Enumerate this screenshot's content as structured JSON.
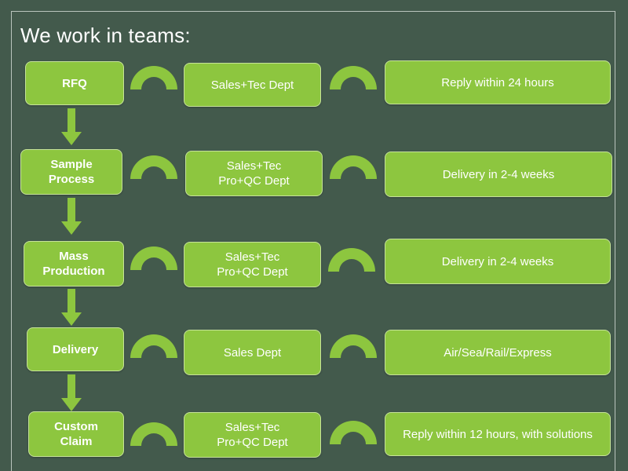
{
  "title": "We work in teams:",
  "colors": {
    "background": "#435a4c",
    "box_fill": "#8dc63f",
    "text": "#ffffff"
  },
  "rows": [
    {
      "step": "RFQ",
      "team": "Sales+Tec Dept",
      "result": "Reply within 24 hours"
    },
    {
      "step": "Sample\nProcess",
      "team": "Sales+Tec\nPro+QC Dept",
      "result": "Delivery in 2-4 weeks"
    },
    {
      "step": "Mass\nProduction",
      "team": "Sales+Tec\nPro+QC Dept",
      "result": "Delivery in 2-4 weeks"
    },
    {
      "step": "Delivery",
      "team": "Sales Dept",
      "result": "Air/Sea/Rail/Express"
    },
    {
      "step": "Custom\nClaim",
      "team": "Sales+Tec\nPro+QC Dept",
      "result": "Reply within 12 hours, with solutions"
    }
  ],
  "icons": {
    "connector": "arc-connector-icon",
    "flow": "arrow-down-icon"
  }
}
